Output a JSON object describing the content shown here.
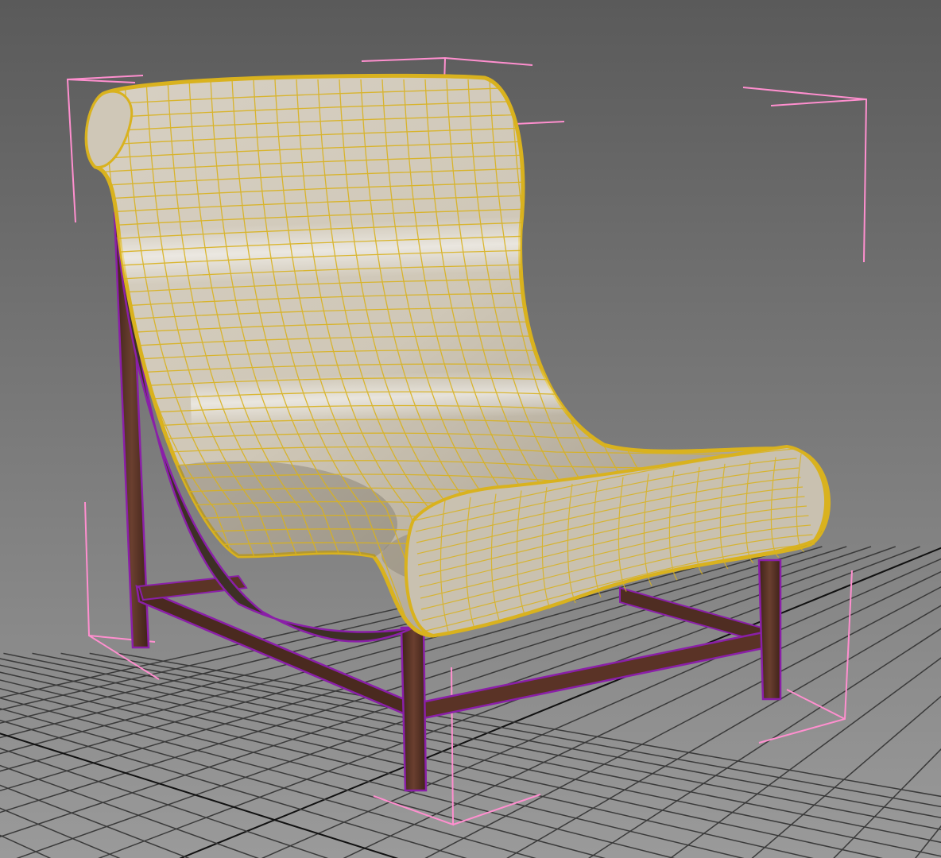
{
  "viewport": {
    "background_top": "#5a5a5a",
    "background_bottom": "#9a9a9a",
    "grid_color": "#3a3a3a",
    "grid_axis_color": "#111111"
  },
  "model": {
    "selection_wire_color": "#d9b21e",
    "frame_wire_color": "#8a1fa8",
    "bounding_box_color": "#ff8fcf",
    "fabric_color": "#d3cbbb",
    "fabric_shadow_color": "#8d8576",
    "wood_color": "#5a3326"
  },
  "icons": {
    "selection_bracket_icon": "selection-bracket-icon"
  }
}
